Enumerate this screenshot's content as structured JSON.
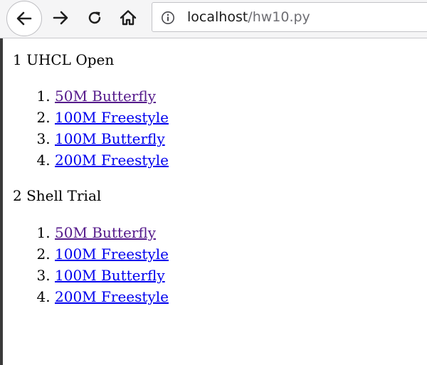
{
  "browser": {
    "url_host": "localhost",
    "url_path": "/hw10.py",
    "icons": [
      "back-arrow-icon",
      "forward-arrow-icon",
      "reload-icon",
      "home-icon",
      "info-icon"
    ]
  },
  "colors": {
    "link": "#0000ee",
    "visited_link": "#551a8b",
    "text": "#000000"
  },
  "meets": [
    {
      "title": "1 UHCL Open",
      "events": [
        {
          "label": "50M Butterfly",
          "visited": true
        },
        {
          "label": "100M Freestyle",
          "visited": false
        },
        {
          "label": "100M Butterfly",
          "visited": false
        },
        {
          "label": "200M Freestyle",
          "visited": false
        }
      ]
    },
    {
      "title": "2 Shell Trial",
      "events": [
        {
          "label": "50M Butterfly",
          "visited": true
        },
        {
          "label": "100M Freestyle",
          "visited": false
        },
        {
          "label": "100M Butterfly",
          "visited": false
        },
        {
          "label": "200M Freestyle",
          "visited": false
        }
      ]
    }
  ]
}
